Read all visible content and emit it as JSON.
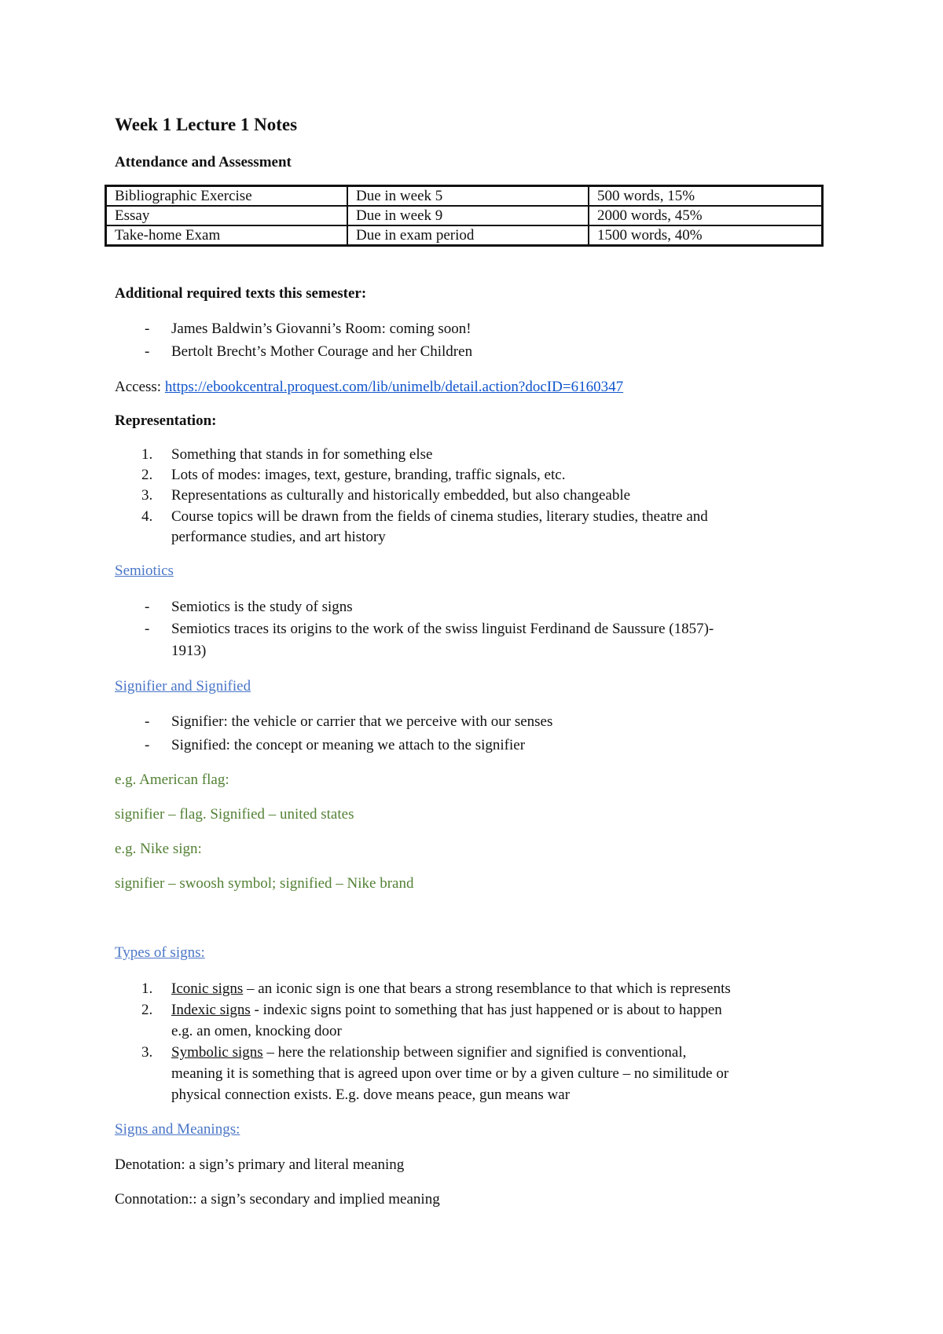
{
  "document": {
    "title": "Week 1 Lecture 1 Notes",
    "attendance_heading": "Attendance and Assessment",
    "assessment_table": {
      "rows": [
        [
          "Bibliographic Exercise",
          "Due in week 5",
          "500 words, 15%"
        ],
        [
          "Essay",
          "Due in week 9",
          "2000 words, 45%"
        ],
        [
          "Take-home Exam",
          "Due in exam period",
          "1500 words, 40%"
        ]
      ]
    },
    "required_texts": {
      "heading": "Additional required texts this semester:",
      "items": [
        "James Baldwin’s Giovanni’s Room: coming soon!",
        "Bertolt Brecht’s Mother Courage and her Children"
      ],
      "access_label": "Access: ",
      "access_link": "https://ebookcentral.proquest.com/lib/unimelb/detail.action?docID=6160347"
    },
    "representation": {
      "heading": "Representation:",
      "items": [
        "Something that stands in for something else",
        "Lots of modes: images, text, gesture, branding, traffic signals, etc.",
        "Representations as culturally and historically embedded, but also changeable",
        "Course topics will be drawn from the fields of cinema studies, literary studies, theatre and",
        "performance studies, and art history"
      ]
    },
    "semiotics": {
      "heading": "Semiotics",
      "items": [
        "Semiotics is the study of signs",
        "Semiotics traces its origins to the work of the swiss linguist Ferdinand de Saussure (1857)-",
        "1913)"
      ]
    },
    "signifier_signified": {
      "heading": "Signifier and Signified",
      "items": [
        "Signifier: the vehicle or carrier that we perceive with our senses",
        "Signified: the concept or meaning we attach to the signifier"
      ],
      "examples": [
        "e.g. American flag:",
        "signifier – flag. Signified – united states",
        "e.g. Nike sign:",
        "signifier – swoosh symbol; signified – Nike brand"
      ]
    },
    "types_of_signs": {
      "heading": "Types of signs:",
      "items": [
        {
          "term": "Iconic signs",
          "text": " – an iconic sign is one that bears a strong resemblance to that which is represents"
        },
        {
          "term": "Indexic signs",
          "text": " - indexic signs point to something that has just happened or is about to happen",
          "cont": [
            "e.g. an omen, knocking door"
          ]
        },
        {
          "term": "Symbolic signs",
          "text": " – here the relationship between signifier and signified is conventional,",
          "cont": [
            "meaning it is something that is agreed upon over time or by a given culture – no similitude or",
            "physical connection exists. E.g. dove means peace, gun means war"
          ]
        }
      ]
    },
    "signs_meanings": {
      "heading": "Signs and Meanings:",
      "denotation": "Denotation: a sign’s primary and literal meaning",
      "connotation": "Connotation:: a sign’s secondary and implied meaning"
    },
    "markers": {
      "dash": "-",
      "n1": "1.",
      "n2": "2.",
      "n3": "3.",
      "n4": "4."
    },
    "colors": {
      "text": "#111111",
      "link": "#1155cc",
      "heading_link": "#4a76c7",
      "example_green": "#538135"
    }
  }
}
